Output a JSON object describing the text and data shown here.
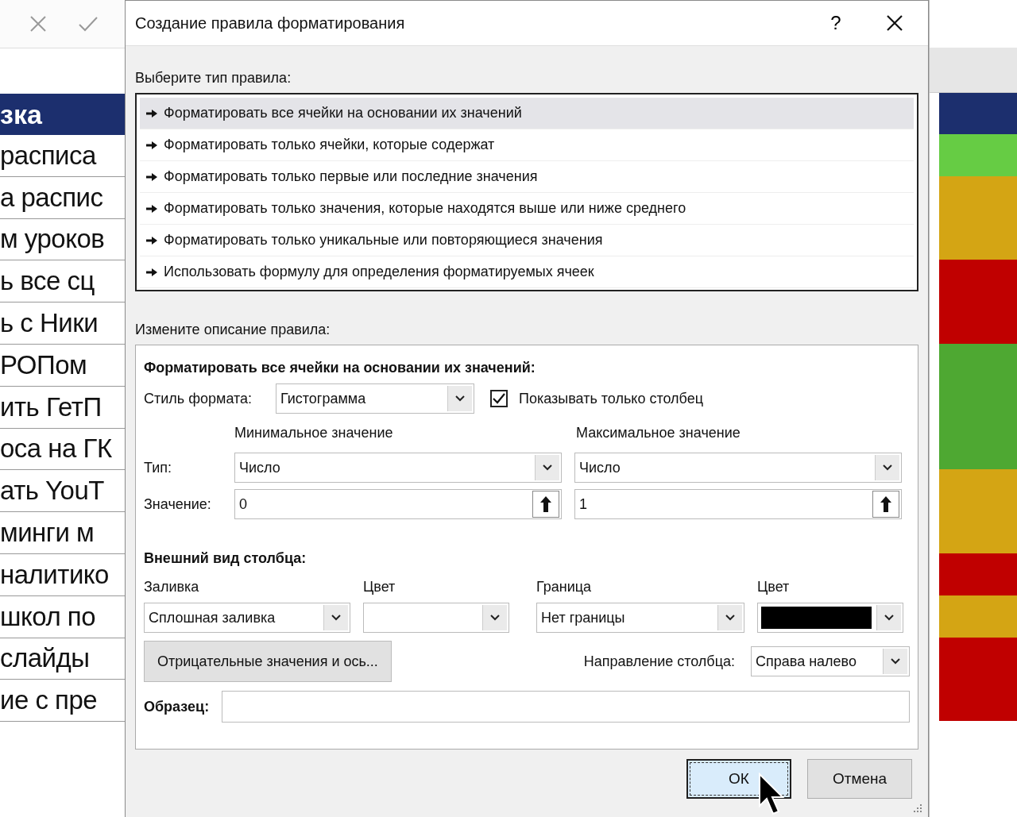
{
  "sheet": {
    "header": "зка",
    "rows": [
      {
        "text": "расписа",
        "color": "#66cc44"
      },
      {
        "text": "а распис",
        "color": "#d4a514"
      },
      {
        "text": "м уроков",
        "color": "#d4a514"
      },
      {
        "text": "ь все сц",
        "color": "#c00000"
      },
      {
        "text": "ь с Ники",
        "color": "#c00000"
      },
      {
        "text": "РОПом",
        "color": "#4ea832"
      },
      {
        "text": "ить ГетП",
        "color": "#4ea832"
      },
      {
        "text": "оса на ГК",
        "color": "#4ea832"
      },
      {
        "text": "ать YouT",
        "color": "#d4a514"
      },
      {
        "text": "минги м",
        "color": "#d4a514"
      },
      {
        "text": "налитико",
        "color": "#c00000"
      },
      {
        "text": "школ по",
        "color": "#d4a514"
      },
      {
        "text": "слайды",
        "color": "#c00000"
      },
      {
        "text": "ие с пре",
        "color": "#c00000"
      }
    ]
  },
  "dialog": {
    "title": "Создание правила форматирования",
    "help_button": "?",
    "rule_type_label": "Выберите тип правила:",
    "rule_types": [
      {
        "label": "Форматировать все ячейки на основании их значений",
        "selected": true
      },
      {
        "label": "Форматировать только ячейки, которые содержат",
        "selected": false
      },
      {
        "label": "Форматировать только первые или последние значения",
        "selected": false
      },
      {
        "label": "Форматировать только значения, которые находятся выше или ниже среднего",
        "selected": false
      },
      {
        "label": "Форматировать только уникальные или повторяющиеся значения",
        "selected": false
      },
      {
        "label": "Использовать формулу для определения форматируемых ячеек",
        "selected": false
      }
    ],
    "description_label": "Измените описание правила:",
    "description": {
      "heading": "Форматировать все ячейки на основании их значений:",
      "format_style": {
        "label": "Стиль формата:",
        "value": "Гистограмма"
      },
      "show_bar_only": {
        "label": "Показывать только столбец",
        "checked": true
      },
      "type_label": "Тип:",
      "value_label": "Значение:",
      "minimum": {
        "heading": "Минимальное значение",
        "type": "Число",
        "value": "0"
      },
      "maximum": {
        "heading": "Максимальное значение",
        "type": "Число",
        "value": "1"
      },
      "appearance_heading": "Внешний вид столбца:",
      "fill": {
        "label": "Заливка",
        "value": "Сплошная заливка"
      },
      "fill_color": {
        "label": "Цвет"
      },
      "border": {
        "label": "Граница",
        "value": "Нет границы"
      },
      "border_color": {
        "label": "Цвет",
        "color": "#000000"
      },
      "negative_button": "Отрицательные значения и ось...",
      "direction": {
        "label": "Направление столбца:",
        "value": "Справа налево"
      },
      "preview_label": "Образец:"
    },
    "buttons": [
      {
        "label": "ОК",
        "default": true
      },
      {
        "label": "Отмена",
        "default": false
      }
    ]
  }
}
